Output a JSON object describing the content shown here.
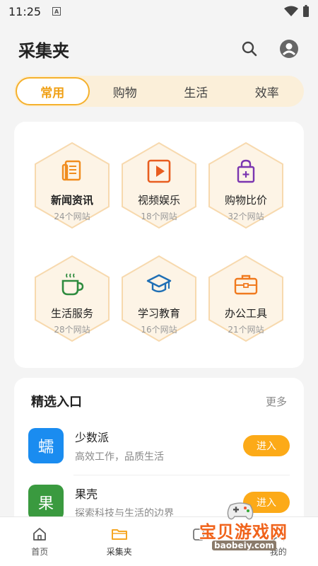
{
  "status_bar": {
    "time": "11:25",
    "notification_letter": "A"
  },
  "header": {
    "title": "采集夹",
    "search_icon": "search-icon",
    "profile_icon": "account-circle-icon"
  },
  "tabs": [
    {
      "label": "常用",
      "active": true
    },
    {
      "label": "购物",
      "active": false
    },
    {
      "label": "生活",
      "active": false
    },
    {
      "label": "效率",
      "active": false
    }
  ],
  "categories": [
    {
      "name": "新闻资讯",
      "count": "24个网站",
      "icon": "newspaper-icon",
      "color": "#f08c1e"
    },
    {
      "name": "视频娱乐",
      "count": "18个网站",
      "icon": "play-video-icon",
      "color": "#e85d1f"
    },
    {
      "name": "购物比价",
      "count": "32个网站",
      "icon": "shopping-bag-icon",
      "color": "#7b35b0"
    },
    {
      "name": "生活服务",
      "count": "28个网站",
      "icon": "coffee-cup-icon",
      "color": "#2e8b3e"
    },
    {
      "name": "学习教育",
      "count": "16个网站",
      "icon": "graduation-cap-icon",
      "color": "#1f6fb5"
    },
    {
      "name": "办公工具",
      "count": "21个网站",
      "icon": "briefcase-icon",
      "color": "#f07a1e"
    }
  ],
  "featured": {
    "title": "精选入口",
    "more_label": "更多",
    "items": [
      {
        "logo_text": "蠕",
        "name": "少数派",
        "desc": "高效工作，品质生活",
        "button": "进入",
        "color": "#1a8cf0"
      },
      {
        "logo_text": "果",
        "name": "果壳",
        "desc": "探索科技与生活的边界",
        "button": "进入",
        "color": "#3a9a3f"
      }
    ]
  },
  "bottom_nav": [
    {
      "label": "首页",
      "icon": "home-icon"
    },
    {
      "label": "采集夹",
      "icon": "folder-icon",
      "active": true
    },
    {
      "label": "",
      "icon": "copy-icon"
    },
    {
      "label": "我的",
      "icon": "person-icon"
    }
  ],
  "watermark": {
    "text": "宝贝游戏网",
    "url": "baobeiy.com"
  },
  "colors": {
    "accent": "#f5b12d",
    "hex_fill": "#fdf4e6",
    "hex_border": "#f7d9ae",
    "button": "#fcaa18"
  }
}
